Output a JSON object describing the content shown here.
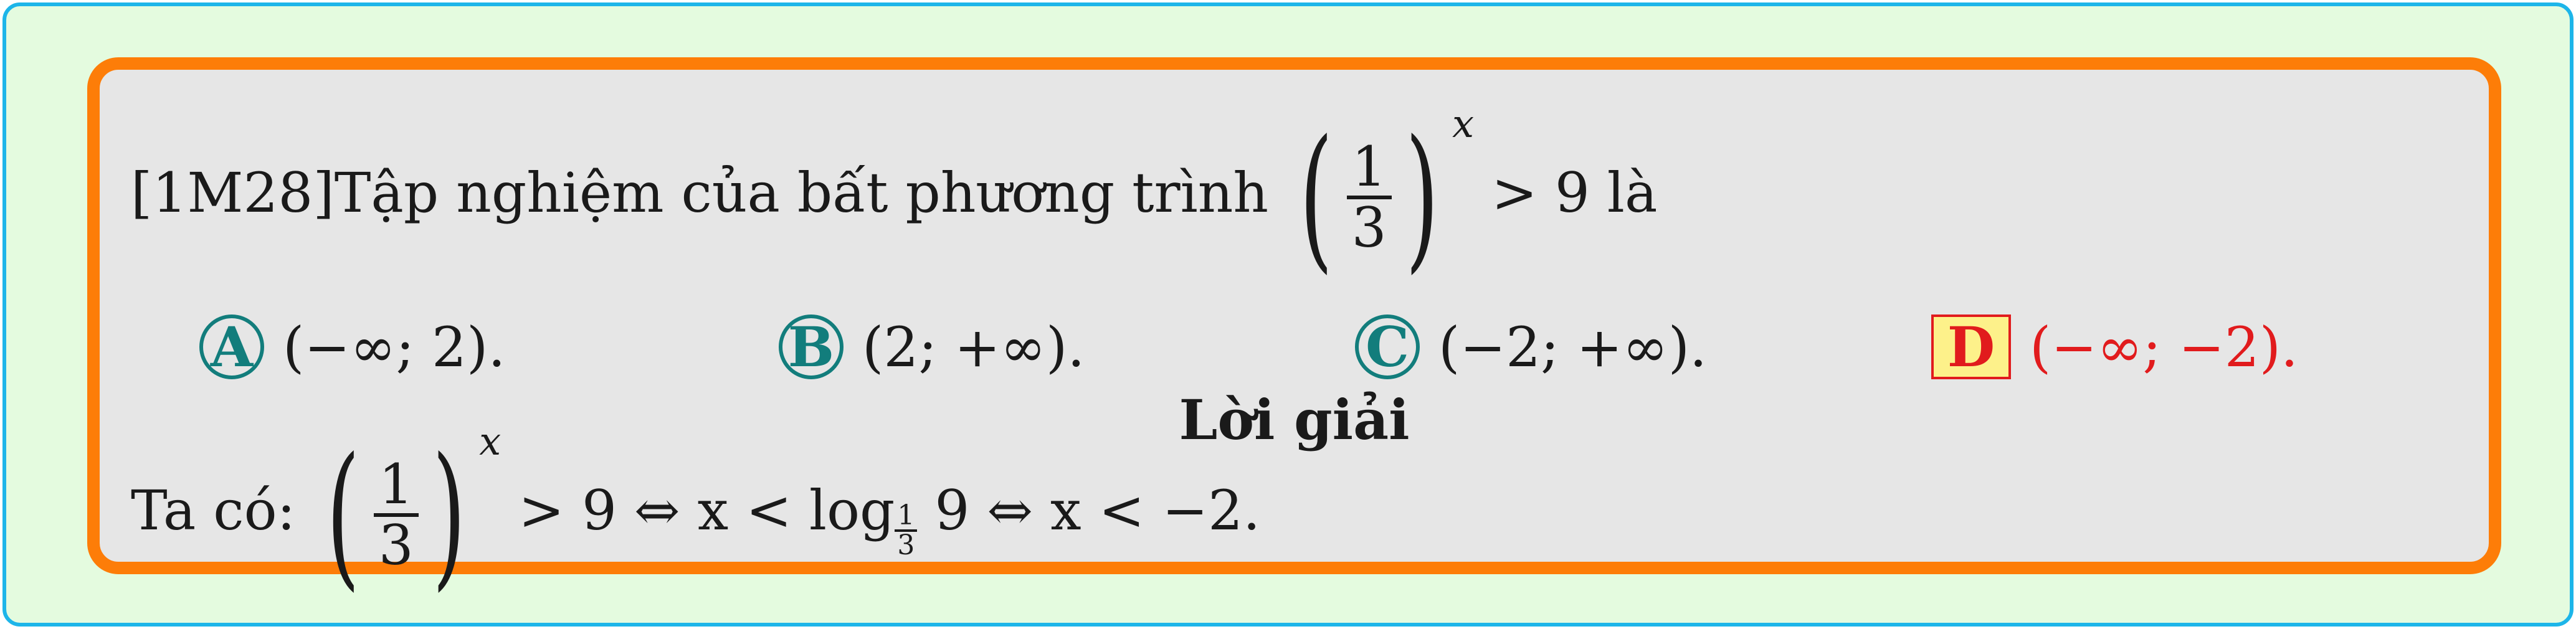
{
  "question": {
    "id_tag": "[1M28]",
    "text": "Tập nghiệm của bất phương trình",
    "base_numerator": "1",
    "base_denominator": "3",
    "exponent": "x",
    "relation": "> 9 là"
  },
  "options": [
    {
      "letter": "A",
      "text": "(−∞; 2).",
      "correct": false
    },
    {
      "letter": "B",
      "text": "(2; +∞).",
      "correct": false
    },
    {
      "letter": "C",
      "text": "(−2; +∞).",
      "correct": false
    },
    {
      "letter": "D",
      "text": "(−∞; −2).",
      "correct": true
    }
  ],
  "solution": {
    "title": "Lời giải",
    "intro": "Ta có:",
    "base_numerator": "1",
    "base_denominator": "3",
    "exponent": "x",
    "step1": "> 9 ⇔ x < log",
    "log_base_numerator": "1",
    "log_base_denominator": "3",
    "step2": "9 ⇔ x < −2."
  },
  "colors": {
    "outer_border": "#1db5e9",
    "outer_fill": "#e4fbdf",
    "card_border": "#fd7d08",
    "card_fill": "#e6e6e6",
    "option_badge": "#127d7c",
    "correct_answer": "#e11b1d",
    "correct_badge_fill": "#fdf18a"
  }
}
